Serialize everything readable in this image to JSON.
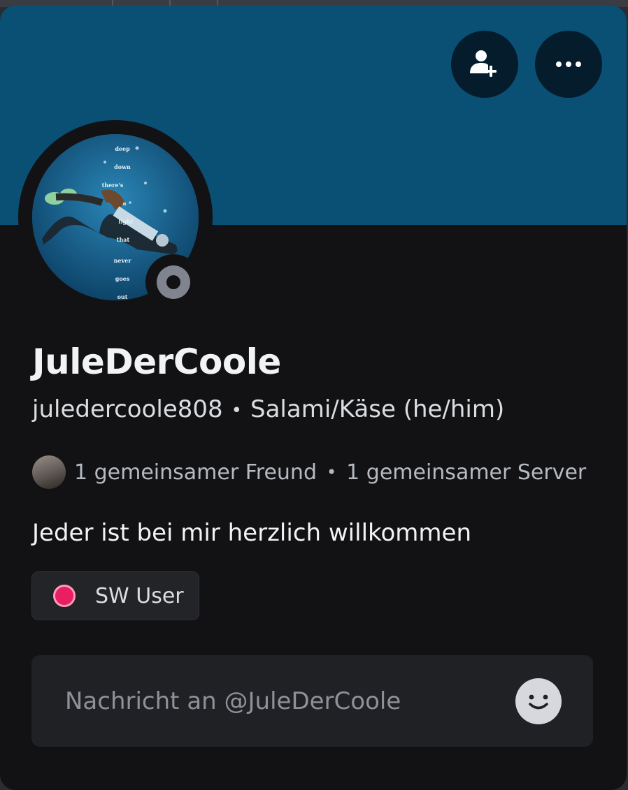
{
  "colors": {
    "banner": "#0a4f74",
    "card_background": "#121214",
    "status_offline": "#80848e",
    "role_color": "#e91e63"
  },
  "header": {
    "add_friend_icon": "add-friend-icon",
    "more_icon": "more-horizontal-icon"
  },
  "profile": {
    "display_name": "JuleDerCoole",
    "username": "juledercoole808",
    "pronouns": "Salami/Käse (he/him)",
    "status": "offline",
    "avatar_words": [
      "deep",
      "down",
      "there's",
      "a",
      "light",
      "that",
      "never",
      "goes",
      "out"
    ]
  },
  "mutuals": {
    "friends": "1 gemeinsamer Freund",
    "servers": "1 gemeinsamer Server"
  },
  "bio": "Jeder ist bei mir herzlich willkommen",
  "roles": [
    {
      "name": "SW User",
      "color": "#e91e63"
    }
  ],
  "message": {
    "placeholder": "Nachricht an @JuleDerCoole",
    "value": "",
    "emoji_icon": "emoji-smile-icon"
  }
}
